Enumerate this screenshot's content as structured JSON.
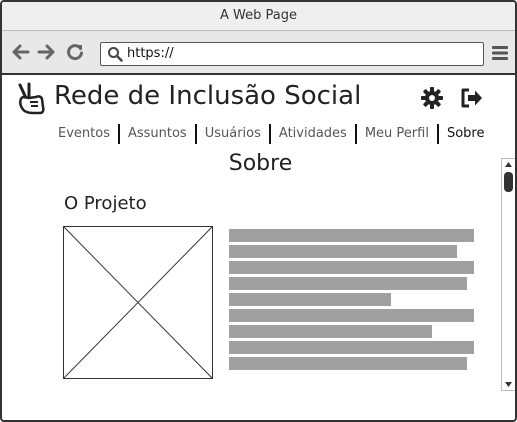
{
  "window": {
    "title": "A Web Page"
  },
  "toolbar": {
    "url": "https://",
    "back_icon": "arrow-left-icon",
    "forward_icon": "arrow-right-icon",
    "reload_icon": "reload-icon",
    "menu_icon": "hamburger-menu-icon"
  },
  "header": {
    "logo_icon": "peace-hand-icon",
    "title": "Rede de Inclusão Social",
    "settings_icon": "gear-icon",
    "logout_icon": "logout-icon"
  },
  "tabs": [
    {
      "label": "Eventos",
      "active": false
    },
    {
      "label": "Assuntos",
      "active": false
    },
    {
      "label": "Usuários",
      "active": false
    },
    {
      "label": "Atividades",
      "active": false
    },
    {
      "label": "Meu Perfil",
      "active": false
    },
    {
      "label": "Sobre",
      "active": true
    }
  ],
  "main": {
    "heading": "Sobre",
    "section_title": "O Projeto",
    "image_placeholder": "image-placeholder",
    "text_line_fractions": [
      1.0,
      0.93,
      1.0,
      0.97,
      0.66,
      1.0,
      0.83,
      1.0,
      0.97
    ]
  },
  "colors": {
    "text_bar": "#a0a0a0",
    "border": "#333333",
    "chrome_bg": "#e8e8e8"
  }
}
